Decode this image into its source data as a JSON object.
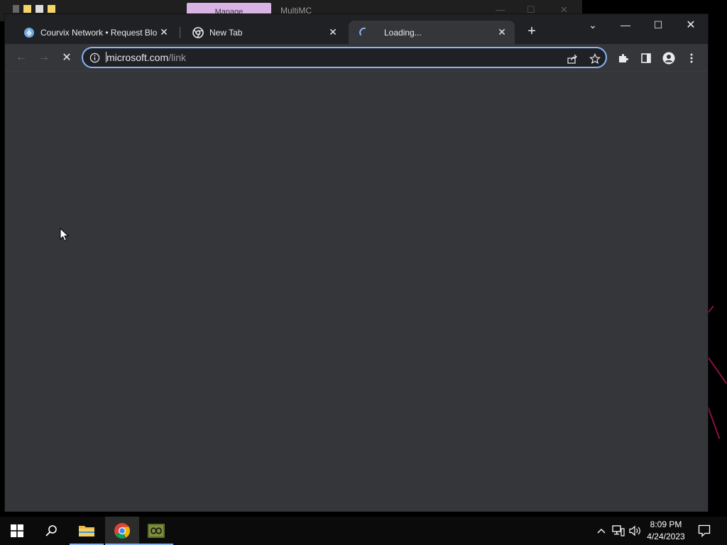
{
  "background_window": {
    "ribbon_tab": "Manage",
    "title": "MultiMC"
  },
  "browser": {
    "tabs": [
      {
        "title": "Courvix Network • Request Block",
        "close": "✕"
      },
      {
        "title": "New Tab",
        "close": "✕"
      },
      {
        "title": "Loading...",
        "close": "✕"
      }
    ],
    "new_tab": "+",
    "window_controls": {
      "tab_search": "⌄",
      "minimize": "—",
      "maximize": "☐",
      "close": "✕"
    },
    "nav": {
      "back": "←",
      "forward": "→",
      "stop": "✕"
    },
    "omnibox": {
      "host": "microsoft.com",
      "path": "/link"
    }
  },
  "taskbar": {
    "apps": [
      "start",
      "search",
      "file-explorer",
      "chrome",
      "multimc"
    ],
    "clock": {
      "time": "8:09 PM",
      "date": "4/24/2023"
    }
  },
  "colors": {
    "accent": "#8ab4f8",
    "tabstrip": "#202124",
    "toolbar": "#35363a",
    "content": "#35363a"
  }
}
